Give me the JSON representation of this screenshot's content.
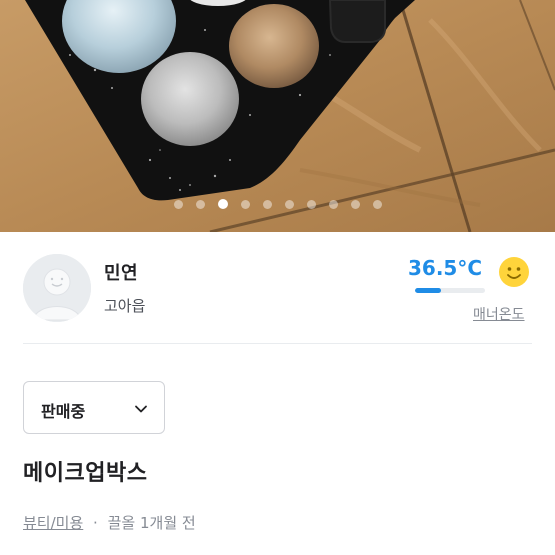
{
  "product_image": {
    "carousel": {
      "count": 10,
      "active_index": 2
    }
  },
  "seller": {
    "avatar_icon": "default-profile-avatar",
    "name": "민연",
    "region": "고아읍",
    "manner_temperature": "36.5°C",
    "manner_temperature_fill": 0.365,
    "manner_icon": "smile-face-icon",
    "manner_label": "매너온도"
  },
  "listing": {
    "status": "판매중",
    "title": "메이크업박스",
    "category": "뷰티/미용",
    "separator": "·",
    "bumped": "끌올",
    "time_ago": "1개월 전"
  },
  "colors": {
    "accent_blue": "#1f8ce6",
    "text_primary": "#212124",
    "text_secondary": "#868b94"
  }
}
